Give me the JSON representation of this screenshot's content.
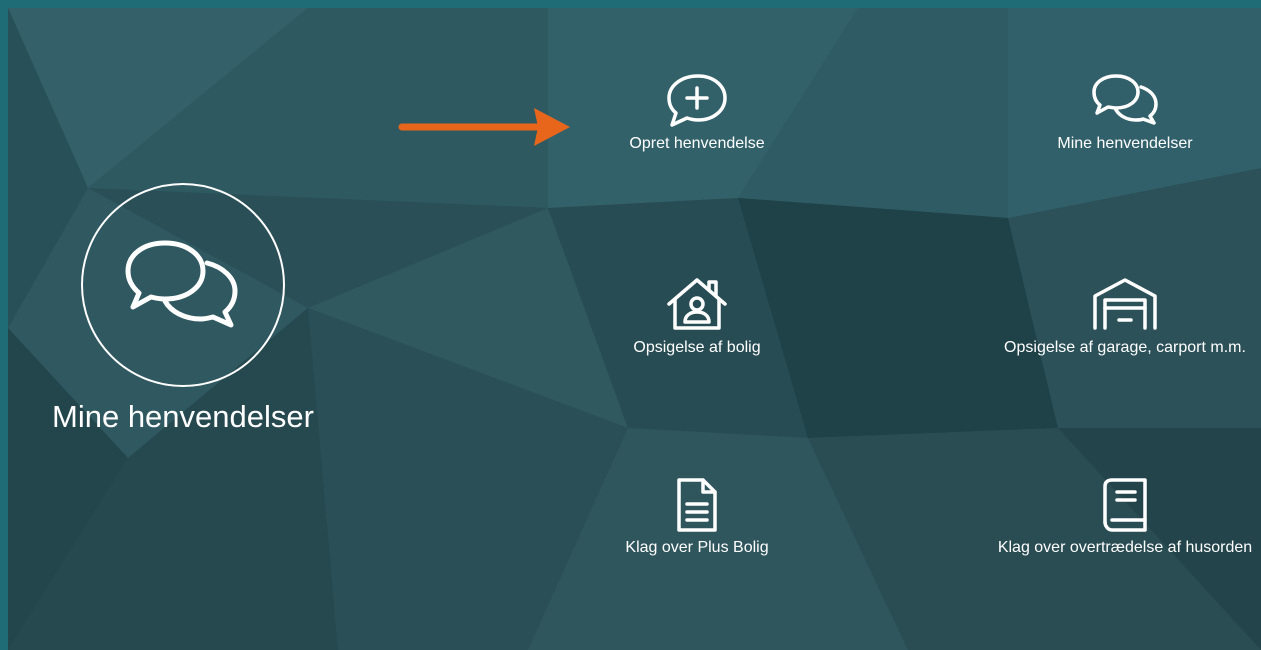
{
  "page": {
    "hero_title": "Mine henvendelser",
    "hero_icon": "chat-bubbles-icon"
  },
  "colors": {
    "outer_frame": "#1f6c76",
    "background": "#2c525a",
    "text": "#ffffff",
    "arrow": "#e8661b"
  },
  "annotation": {
    "arrow_icon": "orange-arrow-right-icon"
  },
  "tiles": [
    {
      "label": "Opret henvendelse",
      "icon": "chat-plus-icon"
    },
    {
      "label": "Mine henvendelser",
      "icon": "chat-bubbles-icon"
    },
    {
      "label": "Opsigelse af bolig",
      "icon": "house-person-icon"
    },
    {
      "label": "Opsigelse af garage, carport m.m.",
      "icon": "garage-icon"
    },
    {
      "label": "Klag over Plus Bolig",
      "icon": "document-icon"
    },
    {
      "label": "Klag over overtrædelse af husorden",
      "icon": "book-icon"
    }
  ]
}
